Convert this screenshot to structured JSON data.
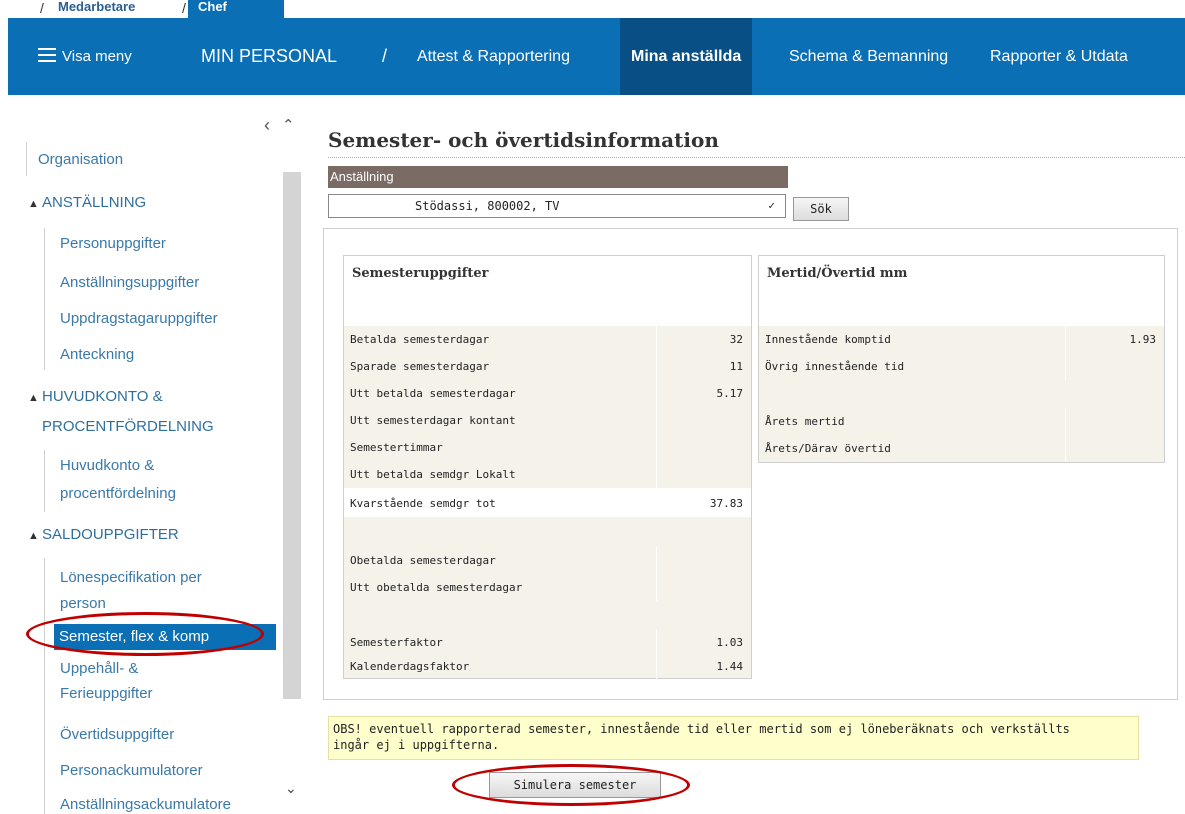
{
  "role_tabs": {
    "inactive": "Medarbetare",
    "active": "Chef"
  },
  "nav": {
    "menu_label": "Visa meny",
    "section": "MIN PERSONAL",
    "separator": "/",
    "items": [
      "Attest & Rapportering",
      "Mina anställda",
      "Schema & Bemanning",
      "Rapporter & Utdata"
    ],
    "active_item": "Mina anställda"
  },
  "sidebar": {
    "organisation": "Organisation",
    "groups": [
      {
        "title": "ANSTÄLLNING",
        "items": [
          "Personuppgifter",
          "Anställningsuppgifter",
          "Uppdragstagaruppgifter",
          "Anteckning"
        ]
      },
      {
        "title_line1": "HUVUDKONTO &",
        "title_line2": "PROCENTFÖRDELNING",
        "items_line1": "Huvudkonto &",
        "items_line2": "procentfördelning"
      },
      {
        "title": "SALDOUPPGIFTER",
        "item1_line1": "Lönespecifikation per",
        "item1_line2": "person",
        "selected": "Semester, flex & komp",
        "item3_line1": "Uppehåll- &",
        "item3_line2": "Ferieuppgifter",
        "item4": "Övertidsuppgifter",
        "item5": "Personackumulatorer",
        "item6": "Anställningsackumulatore"
      }
    ]
  },
  "main": {
    "title": "Semester- och övertidsinformation",
    "employment_label": "Anställning",
    "employee_select_value": "Stödassi, 800002, TV",
    "search_button": "Sök",
    "vacation": {
      "title": "Semesteruppgifter",
      "rows": [
        {
          "label": "Betalda semesterdagar",
          "value": "32"
        },
        {
          "label": "Sparade semesterdagar",
          "value": "11"
        },
        {
          "label": "Utt betalda semesterdagar",
          "value": "5.17"
        },
        {
          "label": "Utt semesterdagar kontant",
          "value": ""
        },
        {
          "label": "Semestertimmar",
          "value": ""
        },
        {
          "label": "Utt betalda semdgr Lokalt",
          "value": ""
        },
        {
          "label": "Kvarstående semdgr tot",
          "value": "37.83"
        },
        {
          "label": "Obetalda semesterdagar",
          "value": ""
        },
        {
          "label": "Utt obetalda semesterdagar",
          "value": ""
        },
        {
          "label": "Semesterfaktor",
          "value": "1.03"
        },
        {
          "label": "Kalenderdagsfaktor",
          "value": "1.44"
        }
      ]
    },
    "overtime": {
      "title": "Mertid/Övertid mm",
      "rows": [
        {
          "label": "Innestående komptid",
          "value": "1.93"
        },
        {
          "label": "Övrig innestående tid",
          "value": ""
        },
        {
          "label": "Årets mertid",
          "value": ""
        },
        {
          "label": "Årets/Därav övertid",
          "value": ""
        }
      ]
    },
    "notice_line1": "OBS! eventuell rapporterad semester, innestående tid eller mertid som ej löneberäknats och verkställts",
    "notice_line2": "ingår ej i uppgifterna.",
    "simulate_button": "Simulera semester"
  },
  "colors": {
    "brand": "#0a6fb4",
    "brand_dark": "#084f85",
    "highlight": "#c00000",
    "notice_bg": "#ffffcc"
  },
  "icons": [
    "hamburger-icon",
    "chevron-left-icon",
    "chevron-up-icon",
    "chevron-down-icon",
    "dropdown-arrow-icon"
  ]
}
